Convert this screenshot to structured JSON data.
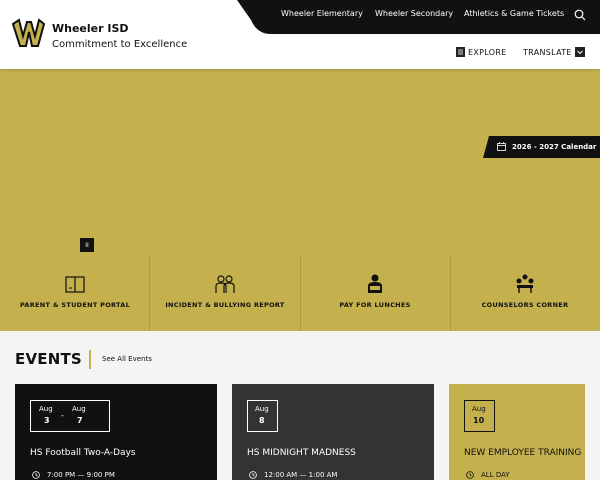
{
  "header": {
    "title": "Wheeler ISD",
    "tagline": "Commitment to Excellence",
    "top_links": [
      "Wheeler Elementary",
      "Wheeler Secondary",
      "Athletics & Game Tickets"
    ],
    "explore_label": "EXPLORE",
    "translate_label": "TRANSLATE"
  },
  "hero": {
    "calendar_label": "2026 - 2027 Calendar",
    "pause_label": "II",
    "quick_links": [
      {
        "label": "PARENT & STUDENT PORTAL",
        "icon": "book-icon"
      },
      {
        "label": "INCIDENT & BULLYING REPORT",
        "icon": "people-icon"
      },
      {
        "label": "PAY FOR LUNCHES",
        "icon": "lunch-icon"
      },
      {
        "label": "COUNSELORS CORNER",
        "icon": "group-icon"
      }
    ]
  },
  "events": {
    "title": "EVENTS",
    "see_all": "See All Events",
    "items": [
      {
        "start_month": "Aug",
        "start_day": "3",
        "sep": "-",
        "end_month": "Aug",
        "end_day": "7",
        "title": "HS Football Two-A-Days",
        "time": "7:00 PM — 9:00 PM"
      },
      {
        "start_month": "Aug",
        "start_day": "8",
        "title": "HS MIDNIGHT MADNESS",
        "time": "12:00 AM — 1:00 AM"
      },
      {
        "start_month": "Aug",
        "start_day": "10",
        "title": "NEW EMPLOYEE TRAINING",
        "time": "ALL DAY"
      }
    ]
  },
  "colors": {
    "gold": "#c4b14d",
    "black": "#111111",
    "dark_gray": "#333333"
  }
}
